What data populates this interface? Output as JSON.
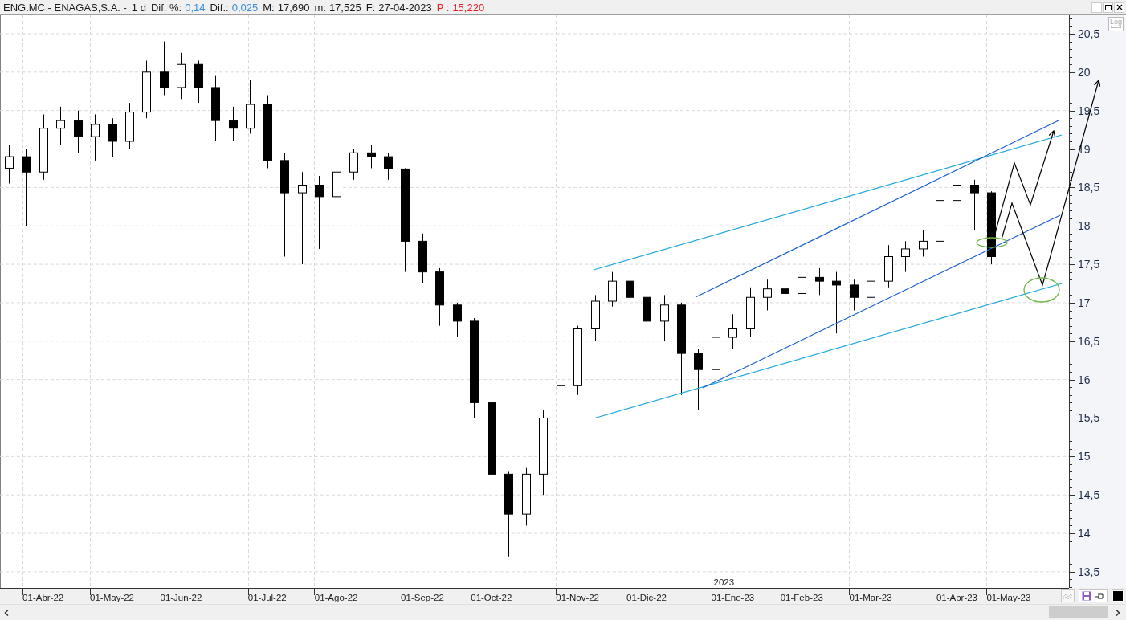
{
  "title_bar": {
    "name": "ENG.MC - ENAGAS,S.A. -",
    "period": "1 d",
    "fields": [
      {
        "label": "Dif. %:",
        "value": "0,14",
        "color": "#3b8fd9",
        "highlighted": false
      },
      {
        "label": "Dif.:",
        "value": "0,025",
        "color": "#3b8fd9",
        "highlighted": false
      },
      {
        "label": "M:",
        "value": "17,690",
        "color": "#1a1a1a",
        "highlighted": false
      },
      {
        "label": "m:",
        "value": "17,525",
        "color": "#1a1a1a",
        "highlighted": false
      },
      {
        "label": "F:",
        "value": "27-04-2023",
        "color": "#1a1a1a",
        "highlighted": false
      },
      {
        "label": "P :",
        "value": "15,220",
        "color": "#e8202a",
        "highlighted": true
      }
    ]
  },
  "log_button": {
    "label": "Log"
  },
  "chart": {
    "year_marker": "2023",
    "chart_data": {
      "type": "candlestick",
      "grid": true,
      "ylim": [
        13.29,
        20.74
      ],
      "categories": [
        null,
        null,
        "01-Abr-22",
        null,
        null,
        null,
        "01-May-22",
        null,
        null,
        null,
        "01-Jun-22",
        null,
        null,
        null,
        null,
        "01-Jul-22",
        null,
        null,
        null,
        "01-Ago-22",
        null,
        null,
        null,
        null,
        "01-Sep-22",
        null,
        null,
        null,
        "01-Oct-22",
        null,
        null,
        null,
        null,
        "01-Nov-22",
        null,
        null,
        null,
        "01-Dic-22",
        null,
        null,
        null,
        null,
        "01-Ene-23",
        null,
        null,
        null,
        "01-Feb-23",
        null,
        null,
        null,
        "01-Mar-23",
        null,
        null,
        null,
        null,
        "01-Abr-23",
        null,
        null,
        "01-May-23",
        null,
        null,
        null
      ],
      "ohlc": [
        [
          18.75,
          19.05,
          18.55,
          18.9
        ],
        [
          18.9,
          19.0,
          18.0,
          18.7
        ],
        [
          18.7,
          19.45,
          18.6,
          19.27
        ],
        [
          19.27,
          19.55,
          19.05,
          19.37
        ],
        [
          19.37,
          19.5,
          18.95,
          19.16
        ],
        [
          19.16,
          19.45,
          18.85,
          19.32
        ],
        [
          19.32,
          19.4,
          18.9,
          19.1
        ],
        [
          19.1,
          19.6,
          19.0,
          19.48
        ],
        [
          19.48,
          20.15,
          19.4,
          20.0
        ],
        [
          20.0,
          20.4,
          19.7,
          19.8
        ],
        [
          19.8,
          20.25,
          19.65,
          20.1
        ],
        [
          20.1,
          20.15,
          19.6,
          19.8
        ],
        [
          19.8,
          19.95,
          19.1,
          19.37
        ],
        [
          19.37,
          19.55,
          19.1,
          19.27
        ],
        [
          19.27,
          19.9,
          19.2,
          19.58
        ],
        [
          19.58,
          19.7,
          18.75,
          18.85
        ],
        [
          18.85,
          18.95,
          17.6,
          18.43
        ],
        [
          18.43,
          18.7,
          17.5,
          18.53
        ],
        [
          18.53,
          18.65,
          17.7,
          18.38
        ],
        [
          18.38,
          18.8,
          18.2,
          18.7
        ],
        [
          18.7,
          19.0,
          18.6,
          18.95
        ],
        [
          18.95,
          19.05,
          18.75,
          18.9
        ],
        [
          18.9,
          18.95,
          18.6,
          18.74
        ],
        [
          18.74,
          18.75,
          17.4,
          17.8
        ],
        [
          17.8,
          17.9,
          17.25,
          17.4
        ],
        [
          17.4,
          17.45,
          16.7,
          16.97
        ],
        [
          16.97,
          17.0,
          16.55,
          16.76
        ],
        [
          16.76,
          16.8,
          15.5,
          15.7
        ],
        [
          15.7,
          15.85,
          14.6,
          14.77
        ],
        [
          14.77,
          14.8,
          13.7,
          14.25
        ],
        [
          14.25,
          14.85,
          14.1,
          14.77
        ],
        [
          14.77,
          15.6,
          14.5,
          15.5
        ],
        [
          15.5,
          16.0,
          15.4,
          15.92
        ],
        [
          15.92,
          16.7,
          15.8,
          16.66
        ],
        [
          16.66,
          17.1,
          16.5,
          17.02
        ],
        [
          17.02,
          17.4,
          16.95,
          17.28
        ],
        [
          17.28,
          17.3,
          16.9,
          17.07
        ],
        [
          17.07,
          17.1,
          16.6,
          16.76
        ],
        [
          16.76,
          17.1,
          16.5,
          16.97
        ],
        [
          16.97,
          17.0,
          15.8,
          16.34
        ],
        [
          16.34,
          16.4,
          15.6,
          16.13
        ],
        [
          16.13,
          16.7,
          16.0,
          16.55
        ],
        [
          16.55,
          16.85,
          16.4,
          16.66
        ],
        [
          16.66,
          17.2,
          16.55,
          17.07
        ],
        [
          17.07,
          17.3,
          16.9,
          17.18
        ],
        [
          17.18,
          17.25,
          16.95,
          17.12
        ],
        [
          17.12,
          17.4,
          17.0,
          17.33
        ],
        [
          17.33,
          17.45,
          17.1,
          17.28
        ],
        [
          17.28,
          17.4,
          16.6,
          17.23
        ],
        [
          17.23,
          17.3,
          16.9,
          17.07
        ],
        [
          17.07,
          17.4,
          16.95,
          17.28
        ],
        [
          17.28,
          17.75,
          17.2,
          17.6
        ],
        [
          17.6,
          17.8,
          17.4,
          17.7
        ],
        [
          17.7,
          17.95,
          17.6,
          17.8
        ],
        [
          17.8,
          18.45,
          17.75,
          18.33
        ],
        [
          18.33,
          18.6,
          18.2,
          18.53
        ],
        [
          18.53,
          18.6,
          17.95,
          18.43
        ],
        [
          18.43,
          18.45,
          17.5,
          17.6
        ],
        null,
        null,
        null,
        null
      ],
      "yticks": [
        {
          "value": 13.5,
          "label": "13,5"
        },
        {
          "value": 14,
          "label": "14"
        },
        {
          "value": 14.5,
          "label": "14,5"
        },
        {
          "value": 15,
          "label": "15"
        },
        {
          "value": 15.5,
          "label": "15,5"
        },
        {
          "value": 16,
          "label": "16"
        },
        {
          "value": 16.5,
          "label": "16,5"
        },
        {
          "value": 17,
          "label": "17"
        },
        {
          "value": 17.5,
          "label": "17,5"
        },
        {
          "value": 18,
          "label": "18"
        },
        {
          "value": 18.5,
          "label": "18,5"
        },
        {
          "value": 19,
          "label": "19"
        },
        {
          "value": 19.5,
          "label": "19,5"
        },
        {
          "value": 20,
          "label": "20"
        },
        {
          "value": 20.5,
          "label": "20,5"
        }
      ]
    }
  }
}
